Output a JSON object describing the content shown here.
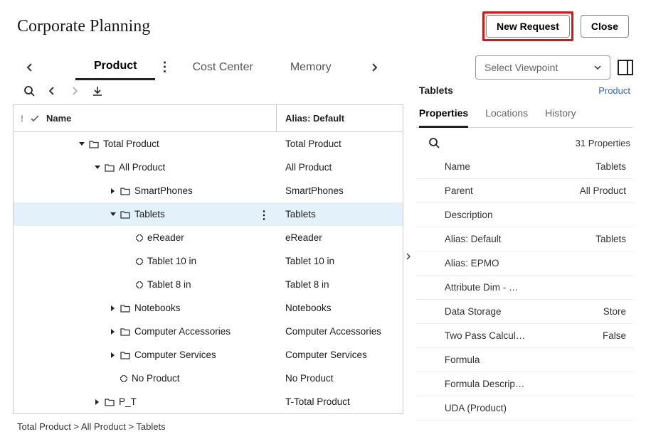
{
  "header": {
    "title": "Corporate Planning",
    "new_request": "New Request",
    "close": "Close"
  },
  "tabs": {
    "items": [
      "Product",
      "Cost Center",
      "Memory"
    ],
    "active_index": 0
  },
  "viewpoint": {
    "placeholder": "Select Viewpoint"
  },
  "grid": {
    "headers": {
      "name": "Name",
      "alias": "Alias: Default"
    },
    "rows": [
      {
        "indent": 0,
        "expander": "down",
        "icon": "folder",
        "name": "Total Product",
        "alias": "Total Product"
      },
      {
        "indent": 1,
        "expander": "down",
        "icon": "folder",
        "name": "All Product",
        "alias": "All Product"
      },
      {
        "indent": 2,
        "expander": "right",
        "icon": "folder",
        "name": "SmartPhones",
        "alias": "SmartPhones"
      },
      {
        "indent": 2,
        "expander": "down",
        "icon": "folder",
        "name": "Tablets",
        "alias": "Tablets",
        "selected": true,
        "menu": true
      },
      {
        "indent": 3,
        "expander": "none",
        "icon": "leaf",
        "name": "eReader",
        "alias": "eReader"
      },
      {
        "indent": 3,
        "expander": "none",
        "icon": "leaf",
        "name": "Tablet 10 in",
        "alias": "Tablet 10 in"
      },
      {
        "indent": 3,
        "expander": "none",
        "icon": "leaf",
        "name": "Tablet 8 in",
        "alias": "Tablet 8 in"
      },
      {
        "indent": 2,
        "expander": "right",
        "icon": "folder",
        "name": "Notebooks",
        "alias": "Notebooks"
      },
      {
        "indent": 2,
        "expander": "right",
        "icon": "folder",
        "name": "Computer Accessories",
        "alias": "Computer Accessories"
      },
      {
        "indent": 2,
        "expander": "right",
        "icon": "folder",
        "name": "Computer Services",
        "alias": "Computer Services"
      },
      {
        "indent": 2,
        "expander": "none",
        "icon": "leaf",
        "name": "No Product",
        "alias": "No Product"
      },
      {
        "indent": 1,
        "expander": "right",
        "icon": "folder",
        "name": "P_T",
        "alias": "T-Total Product"
      }
    ]
  },
  "breadcrumb": "Total Product > All Product > Tablets",
  "details": {
    "title": "Tablets",
    "link": "Product",
    "tabs": [
      "Properties",
      "Locations",
      "History"
    ],
    "active_tab": 0,
    "count_label": "31 Properties",
    "props": [
      {
        "label": "Name",
        "value": "Tablets"
      },
      {
        "label": "Parent",
        "value": "All Product"
      },
      {
        "label": "Description",
        "value": ""
      },
      {
        "label": "Alias: Default",
        "value": "Tablets"
      },
      {
        "label": "Alias: EPMO",
        "value": ""
      },
      {
        "label": "Attribute Dim - …",
        "value": ""
      },
      {
        "label": "Data Storage",
        "value": "Store"
      },
      {
        "label": "Two Pass Calcul…",
        "value": "False"
      },
      {
        "label": "Formula",
        "value": ""
      },
      {
        "label": "Formula Descrip…",
        "value": ""
      },
      {
        "label": "UDA (Product)",
        "value": ""
      }
    ]
  }
}
